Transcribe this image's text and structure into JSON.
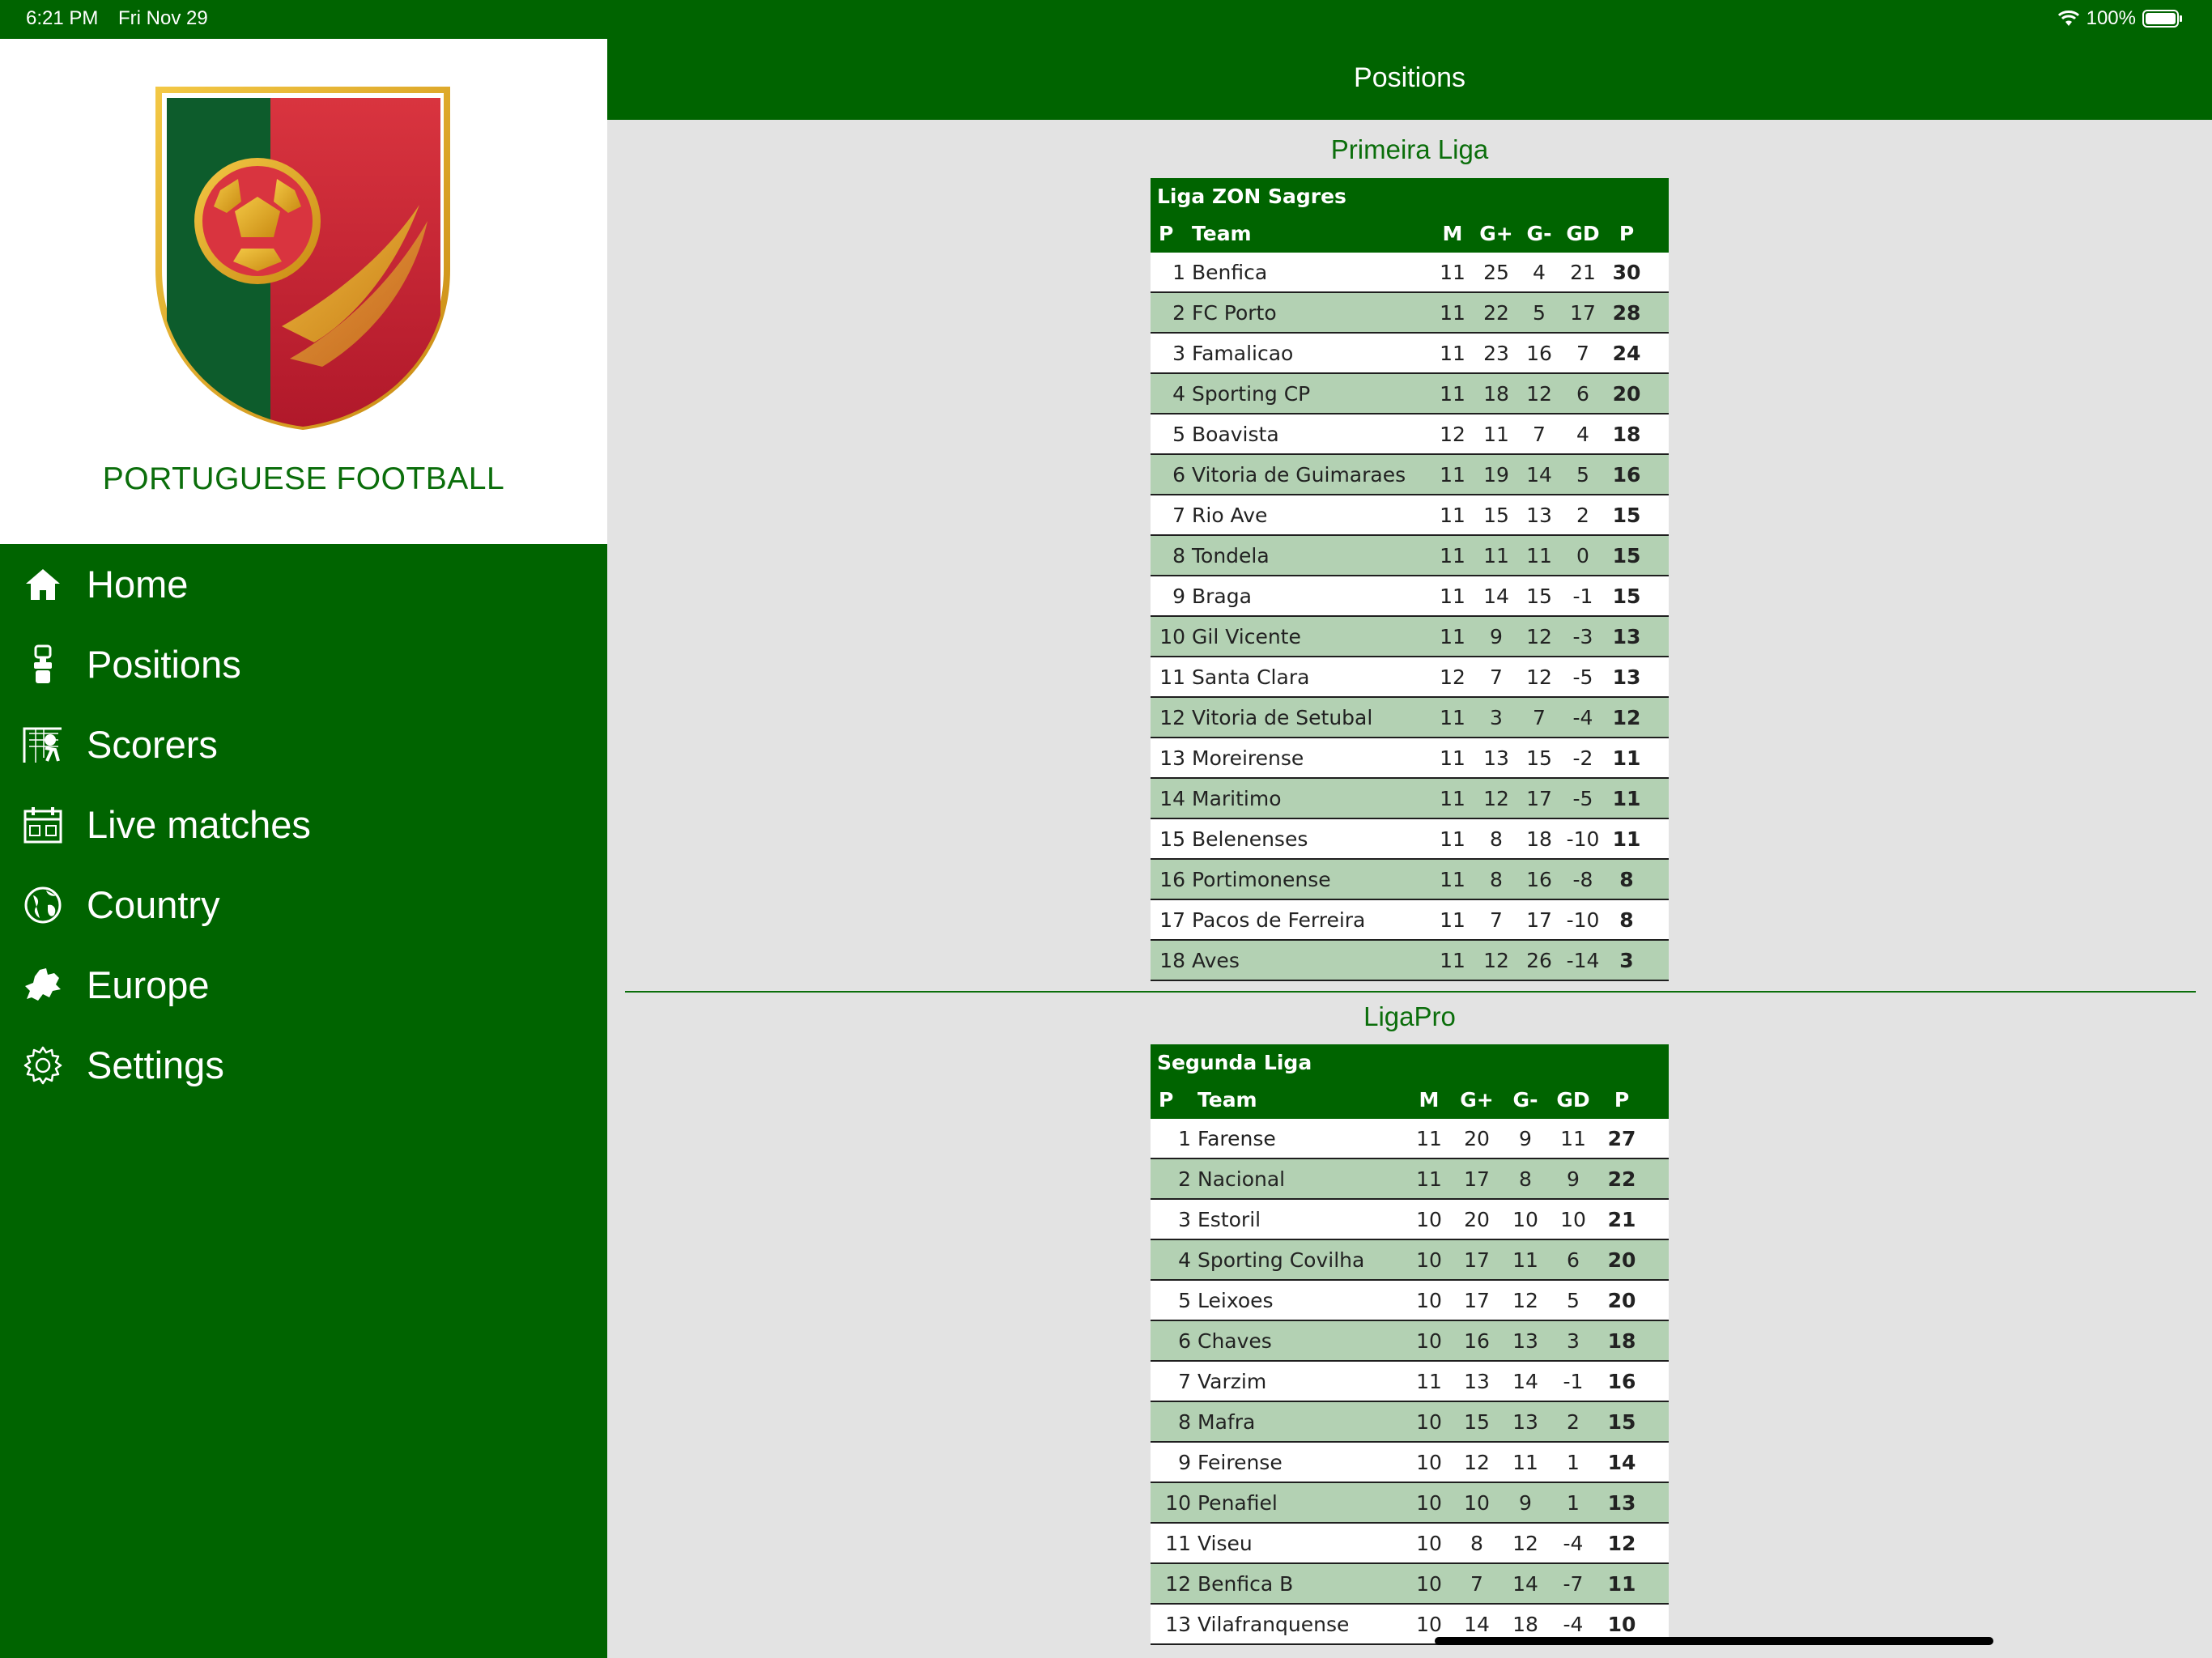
{
  "status": {
    "time": "6:21 PM",
    "date": "Fri Nov 29",
    "battery": "100%"
  },
  "brand": {
    "title": "PORTUGUESE FOOTBALL"
  },
  "menu": [
    {
      "label": "Home",
      "icon": "home-icon"
    },
    {
      "label": "Positions",
      "icon": "trophy-icon"
    },
    {
      "label": "Scorers",
      "icon": "goal-icon"
    },
    {
      "label": "Live matches",
      "icon": "calendar-icon"
    },
    {
      "label": "Country",
      "icon": "globe-icon"
    },
    {
      "label": "Europe",
      "icon": "europe-map-icon"
    },
    {
      "label": "Settings",
      "icon": "gear-icon"
    }
  ],
  "page": {
    "title": "Positions"
  },
  "columns": {
    "p": "P",
    "team": "Team",
    "m": "M",
    "gf": "G+",
    "ga": "G-",
    "gd": "GD",
    "pts": "P"
  },
  "leagues": [
    {
      "title": "Primeira Liga",
      "table_name": "Liga ZON Sagres",
      "rows": [
        [
          "1",
          "Benfica",
          "11",
          "25",
          "4",
          "21",
          "30"
        ],
        [
          "2",
          "FC Porto",
          "11",
          "22",
          "5",
          "17",
          "28"
        ],
        [
          "3",
          "Famalicao",
          "11",
          "23",
          "16",
          "7",
          "24"
        ],
        [
          "4",
          "Sporting CP",
          "11",
          "18",
          "12",
          "6",
          "20"
        ],
        [
          "5",
          "Boavista",
          "12",
          "11",
          "7",
          "4",
          "18"
        ],
        [
          "6",
          "Vitoria de Guimaraes",
          "11",
          "19",
          "14",
          "5",
          "16"
        ],
        [
          "7",
          "Rio Ave",
          "11",
          "15",
          "13",
          "2",
          "15"
        ],
        [
          "8",
          "Tondela",
          "11",
          "11",
          "11",
          "0",
          "15"
        ],
        [
          "9",
          "Braga",
          "11",
          "14",
          "15",
          "-1",
          "15"
        ],
        [
          "10",
          "Gil Vicente",
          "11",
          "9",
          "12",
          "-3",
          "13"
        ],
        [
          "11",
          "Santa Clara",
          "12",
          "7",
          "12",
          "-5",
          "13"
        ],
        [
          "12",
          "Vitoria de Setubal",
          "11",
          "3",
          "7",
          "-4",
          "12"
        ],
        [
          "13",
          "Moreirense",
          "11",
          "13",
          "15",
          "-2",
          "11"
        ],
        [
          "14",
          "Maritimo",
          "11",
          "12",
          "17",
          "-5",
          "11"
        ],
        [
          "15",
          "Belenenses",
          "11",
          "8",
          "18",
          "-10",
          "11"
        ],
        [
          "16",
          "Portimonense",
          "11",
          "8",
          "16",
          "-8",
          "8"
        ],
        [
          "17",
          "Pacos de Ferreira",
          "11",
          "7",
          "17",
          "-10",
          "8"
        ],
        [
          "18",
          "Aves",
          "11",
          "12",
          "26",
          "-14",
          "3"
        ]
      ]
    },
    {
      "title": "LigaPro",
      "table_name": "Segunda Liga",
      "rows": [
        [
          "1",
          "Farense",
          "11",
          "20",
          "9",
          "11",
          "27"
        ],
        [
          "2",
          "Nacional",
          "11",
          "17",
          "8",
          "9",
          "22"
        ],
        [
          "3",
          "Estoril",
          "10",
          "20",
          "10",
          "10",
          "21"
        ],
        [
          "4",
          "Sporting Covilha",
          "10",
          "17",
          "11",
          "6",
          "20"
        ],
        [
          "5",
          "Leixoes",
          "10",
          "17",
          "12",
          "5",
          "20"
        ],
        [
          "6",
          "Chaves",
          "10",
          "16",
          "13",
          "3",
          "18"
        ],
        [
          "7",
          "Varzim",
          "11",
          "13",
          "14",
          "-1",
          "16"
        ],
        [
          "8",
          "Mafra",
          "10",
          "15",
          "13",
          "2",
          "15"
        ],
        [
          "9",
          "Feirense",
          "10",
          "12",
          "11",
          "1",
          "14"
        ],
        [
          "10",
          "Penafiel",
          "10",
          "10",
          "9",
          "1",
          "13"
        ],
        [
          "11",
          "Viseu",
          "10",
          "8",
          "12",
          "-4",
          "12"
        ],
        [
          "12",
          "Benfica B",
          "10",
          "7",
          "14",
          "-7",
          "11"
        ],
        [
          "13",
          "Vilafranquense",
          "10",
          "14",
          "18",
          "-4",
          "10"
        ]
      ]
    }
  ]
}
